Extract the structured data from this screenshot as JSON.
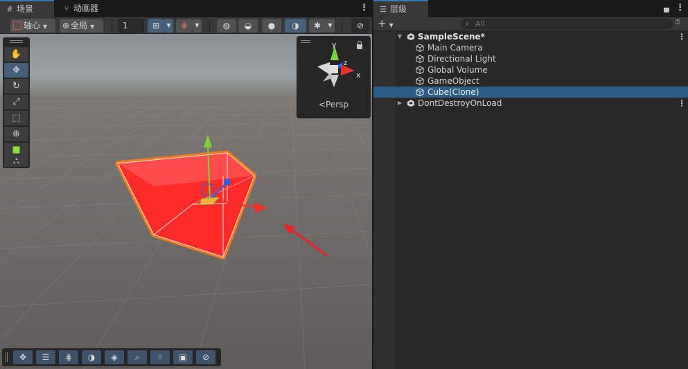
{
  "scene_view": {
    "tabs": [
      {
        "label": "场景",
        "icon": "grid-icon",
        "active": true
      },
      {
        "label": "动画器",
        "icon": "animator-icon",
        "active": false
      }
    ],
    "toolbar": {
      "pivot_label": "轴心",
      "global_label": "全局",
      "grid_size_value": "1"
    },
    "tools": [
      "view-hand",
      "move",
      "rotate",
      "scale",
      "rect",
      "transform",
      "custom-editor",
      "component-tool"
    ],
    "selected_tool": "move",
    "orientation_gizmo": {
      "projection_label": "Persp",
      "axis_labels": {
        "y": "y",
        "z": "z",
        "x": "x"
      }
    },
    "bottom_overlay_tools": [
      "move",
      "align",
      "snap-grid",
      "shading",
      "layers",
      "search",
      "pivot",
      "camera",
      "navigation"
    ]
  },
  "hierarchy": {
    "tab_label": "层级",
    "search_placeholder": "All",
    "rows": [
      {
        "label": "SampleScene*",
        "kind": "scene",
        "expanded": true,
        "selected": false
      },
      {
        "label": "Main Camera",
        "kind": "gameobject",
        "selected": false
      },
      {
        "label": "Directional Light",
        "kind": "gameobject",
        "selected": false
      },
      {
        "label": "Global Volume",
        "kind": "gameobject",
        "selected": false
      },
      {
        "label": "GameObject",
        "kind": "gameobject",
        "selected": false
      },
      {
        "label": "Cube(Clone)",
        "kind": "gameobject",
        "selected": true
      },
      {
        "label": "DontDestroyOnLoad",
        "kind": "scene",
        "expanded": false,
        "selected": false
      }
    ]
  },
  "colors": {
    "selection": "#2c5d87",
    "accent_tab": "#3a79bb",
    "cube": "#ff2a2a",
    "outline": "#ff7a1a",
    "axis_y": "#7bd23f",
    "axis_x": "#e8322c",
    "axis_z": "#2f5fe6"
  }
}
